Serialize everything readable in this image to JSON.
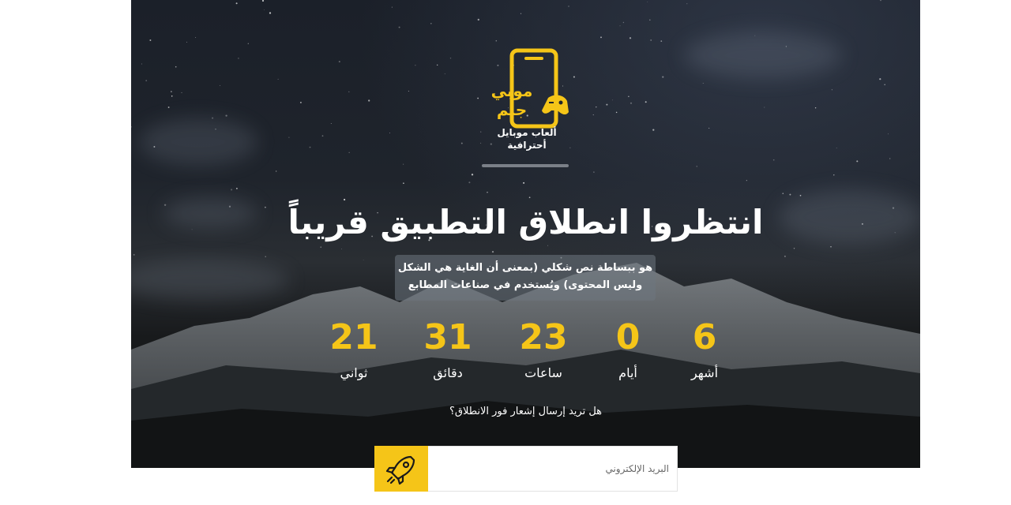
{
  "brand": {
    "logo_text": "موبي جيم",
    "tagline": "ألعاب موبايل أحترافية"
  },
  "hero": {
    "title": "انتظروا انطلاق التطبيق قريباً",
    "description_line1": "هو ببساطة نص شكلي (بمعنى أن الغاية هي الشكل",
    "description_line2": "وليس المحتوى) ويُستخدم في صناعات المطابع"
  },
  "countdown": [
    {
      "value": "6",
      "label": "أشهر"
    },
    {
      "value": "0",
      "label": "أيام"
    },
    {
      "value": "23",
      "label": "ساعات"
    },
    {
      "value": "31",
      "label": "دقائق"
    },
    {
      "value": "21",
      "label": "ثواني"
    }
  ],
  "subscribe": {
    "prompt": "هل تريد إرسال إشعار فور الانطلاق؟",
    "email_placeholder": "البريد الإلكتروني",
    "submit_icon": "rocket-icon"
  },
  "colors": {
    "accent": "#f5c518",
    "background_dark": "#1f242c",
    "text_light": "#ffffff"
  }
}
